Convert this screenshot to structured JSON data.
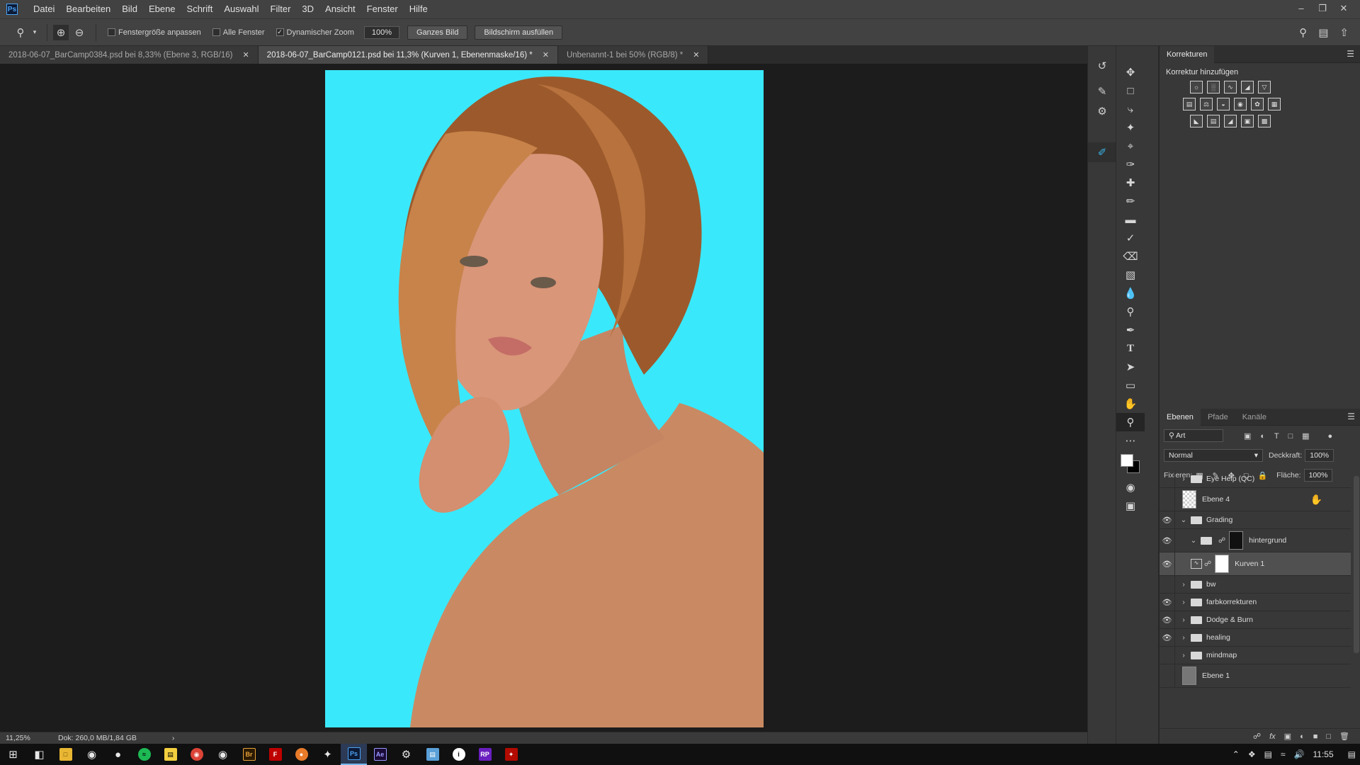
{
  "menubar": {
    "logo": "Ps",
    "items": [
      "Datei",
      "Bearbeiten",
      "Bild",
      "Ebene",
      "Schrift",
      "Auswahl",
      "Filter",
      "3D",
      "Ansicht",
      "Fenster",
      "Hilfe"
    ]
  },
  "options": {
    "check_fit": "Fenstergröße anpassen",
    "check_all": "Alle Fenster",
    "check_dynamic": "Dynamischer Zoom",
    "zoom_value": "100%",
    "btn_whole": "Ganzes Bild",
    "btn_fill": "Bildschirm ausfüllen"
  },
  "tabs": [
    {
      "label": "2018-06-07_BarCamp0384.psd bei 8,33% (Ebene 3, RGB/16)"
    },
    {
      "label": "2018-06-07_BarCamp0121.psd bei 11,3% (Kurven 1, Ebenenmaske/16) *"
    },
    {
      "label": "Unbenannt-1 bei 50% (RGB/8) *"
    }
  ],
  "status": {
    "zoom": "11,25%",
    "doc": "Dok: 260,0 MB/1,84 GB"
  },
  "corrections": {
    "tab": "Korrekturen",
    "subtitle": "Korrektur hinzufügen"
  },
  "layers_panel": {
    "tabs": [
      "Ebenen",
      "Pfade",
      "Kanäle"
    ],
    "filter_kind": "Art",
    "blend_mode": "Normal",
    "opacity_label": "Deckkraft:",
    "opacity_value": "100%",
    "lock_label": "Fixieren:",
    "fill_label": "Fläche:",
    "fill_value": "100%",
    "layers": [
      {
        "name": "Eye Help (QC)"
      },
      {
        "name": "Ebene 4"
      },
      {
        "name": "Grading"
      },
      {
        "name": "hintergrund"
      },
      {
        "name": "Kurven 1"
      },
      {
        "name": "bw"
      },
      {
        "name": "farbkorrekturen"
      },
      {
        "name": "Dodge & Burn"
      },
      {
        "name": "healing"
      },
      {
        "name": "mindmap"
      },
      {
        "name": "Ebene 1"
      }
    ]
  },
  "taskbar": {
    "clock": "11:55"
  },
  "colors": {
    "canvas_bg": "#3ae8fb",
    "accent": "#3ab5e8"
  }
}
